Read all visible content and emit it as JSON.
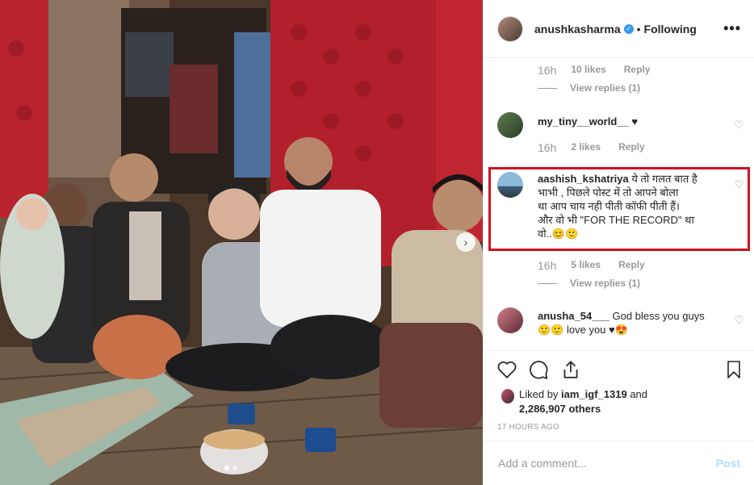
{
  "header": {
    "username": "anushkasharma",
    "verified_icon": "verified-badge-icon",
    "separator": "•",
    "follow_label": "Following",
    "more_label": "•••"
  },
  "comments": [
    {
      "type": "meta-only",
      "time": "16h",
      "likes": "10 likes",
      "reply": "Reply",
      "view_replies": "View replies (1)"
    },
    {
      "username": "my_tiny__world__",
      "text": "♥",
      "time": "16h",
      "likes": "2 likes",
      "reply": "Reply"
    },
    {
      "username": "aashish_kshatriya",
      "text": "ये तो गलत बात है भाभी , पिछले पोस्ट में तो आपने बोला था आप चाय नही पीती कॉफी पीती हैं। और वो भी \"FOR THE RECORD\" था वो..😊🙂",
      "lines": [
        "ये तो गलत बात है",
        "भाभी , पिछले पोस्ट में तो आपने बोला",
        "था आप चाय नही पीती कॉफी पीती हैं।",
        "और वो भी \"FOR THE RECORD\" था",
        "वो..😊🙂"
      ],
      "time": "16h",
      "likes": "5 likes",
      "reply": "Reply",
      "view_replies": "View replies (1)"
    },
    {
      "username": "anusha_54___",
      "text_line1": "God bless you guys",
      "text_line2": "🙂🙂 love you ♥😍"
    }
  ],
  "actions": {
    "like_icon": "heart-icon",
    "comment_icon": "comment-icon",
    "share_icon": "share-icon",
    "save_icon": "bookmark-icon"
  },
  "likes": {
    "prefix": "Liked by ",
    "user": "iam_igf_1319",
    "mid": " and",
    "count": "2,286,907 others"
  },
  "posted_ago": "17 HOURS AGO",
  "add_comment": {
    "placeholder": "Add a comment...",
    "post_label": "Post"
  },
  "colors": {
    "highlight": "#d0121b",
    "verified": "#3897f0",
    "post_disabled": "#b2dffc"
  }
}
